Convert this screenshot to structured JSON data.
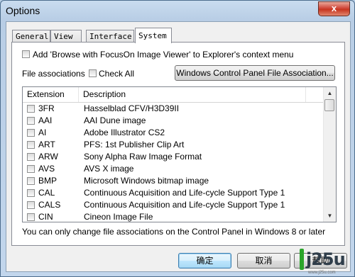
{
  "window": {
    "title": "Options",
    "close_glyph": "x"
  },
  "tabs": [
    {
      "label": "General",
      "active": false
    },
    {
      "label": "View",
      "active": false
    },
    {
      "label": "Interface",
      "active": false
    },
    {
      "label": "System",
      "active": true
    }
  ],
  "system": {
    "browse_option_label": "Add 'Browse with FocusOn Image Viewer' to Explorer's context menu",
    "browse_option_checked": false,
    "file_associations_label": "File associations",
    "check_all_label": "Check All",
    "check_all_checked": false,
    "control_panel_button": "Windows Control Panel File Association...",
    "columns": {
      "extension": "Extension",
      "description": "Description"
    },
    "rows": [
      {
        "ext": "3FR",
        "desc": "Hasselblad CFV/H3D39II"
      },
      {
        "ext": "AAI",
        "desc": "AAI Dune image"
      },
      {
        "ext": "AI",
        "desc": "Adobe Illustrator CS2"
      },
      {
        "ext": "ART",
        "desc": "PFS: 1st Publisher Clip Art"
      },
      {
        "ext": "ARW",
        "desc": "Sony Alpha Raw Image Format"
      },
      {
        "ext": "AVS",
        "desc": "AVS X image"
      },
      {
        "ext": "BMP",
        "desc": "Microsoft Windows bitmap image"
      },
      {
        "ext": "CAL",
        "desc": "Continuous Acquisition and Life-cycle Support Type 1"
      },
      {
        "ext": "CALS",
        "desc": "Continuous Acquisition and Life-cycle Support Type 1"
      },
      {
        "ext": "CIN",
        "desc": "Cineon Image File"
      }
    ],
    "note": "You can only change file associations on the Control Panel in Windows 8 or later"
  },
  "buttons": {
    "ok": "确定",
    "cancel": "取消",
    "help": "帮助"
  },
  "watermark": {
    "text": "j25u",
    "sub": "www.j25u.com"
  },
  "colors": {
    "accent": "#3c7fb1",
    "watermark_green": "#2aa52a",
    "close_red": "#c7351f"
  }
}
